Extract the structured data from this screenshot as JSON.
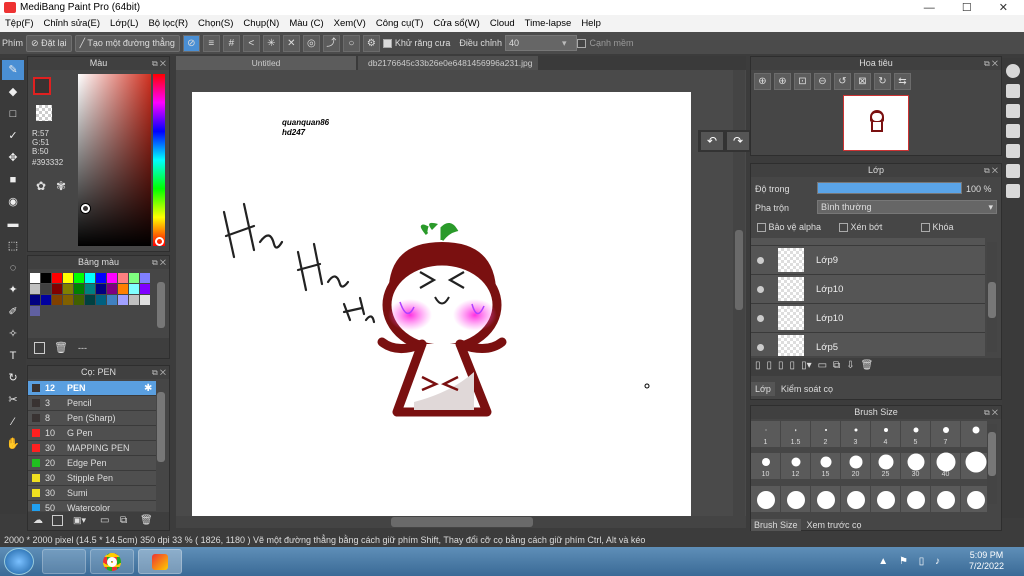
{
  "window": {
    "title": "MediBang Paint Pro (64bit)",
    "controls": "— ☐ ✕"
  },
  "menu": [
    "Tệp(F)",
    "Chỉnh sửa(E)",
    "Lớp(L)",
    "Bộ lọc(R)",
    "Chọn(S)",
    "Chụp(N)",
    "Màu (C)",
    "Xem(V)",
    "Công cụ(T)",
    "Cửa sổ(W)",
    "Cloud",
    "Time-lapse",
    "Help"
  ],
  "toolbar": {
    "label": "Phím",
    "reset": "Đặt lại",
    "straight_line": "Tạo một đường thẳng",
    "antialias": "Khử răng cưa",
    "adjust": "Điều chỉnh",
    "adjust_value": "40",
    "smooth": "Cạnh mềm"
  },
  "color_panel": {
    "title": "Màu",
    "r": "R:57",
    "g": "G:51",
    "b": "B:50",
    "hex": "#393332",
    "primary": "#393332",
    "secondary": "#c8e020"
  },
  "palette_panel": {
    "title": "Bảng màu",
    "footer": "---",
    "colors": [
      "#ffffff",
      "#000000",
      "#ff0000",
      "#ffff00",
      "#00ff00",
      "#00ffff",
      "#0000ff",
      "#ff00ff",
      "#ff8080",
      "#80ff80",
      "#8080ff",
      "#c0c0c0",
      "#404040",
      "#800000",
      "#808000",
      "#008000",
      "#008080",
      "#000080",
      "#800080",
      "#ff8000",
      "#80ffff",
      "#8000ff",
      "#000080",
      "#0000a0",
      "#804000",
      "#806000",
      "#406000",
      "#004040",
      "#006080",
      "#4080c0",
      "#a0a0ff",
      "#c0c0c0",
      "#e0e0e0",
      "#6060a0"
    ]
  },
  "brush_panel": {
    "title": "Cọ: PEN",
    "items": [
      {
        "size": "12",
        "name": "PEN",
        "color": "#393332"
      },
      {
        "size": "3",
        "name": "Pencil",
        "color": "#393332"
      },
      {
        "size": "8",
        "name": "Pen (Sharp)",
        "color": "#393332"
      },
      {
        "size": "10",
        "name": "G Pen",
        "color": "#ff2020"
      },
      {
        "size": "30",
        "name": "MAPPING PEN",
        "color": "#ff2020"
      },
      {
        "size": "20",
        "name": "Edge Pen",
        "color": "#20c020"
      },
      {
        "size": "30",
        "name": "Stipple Pen",
        "color": "#f0e020"
      },
      {
        "size": "30",
        "name": "Sumi",
        "color": "#f0e020"
      },
      {
        "size": "50",
        "name": "Watercolor",
        "color": "#20a0f0"
      }
    ]
  },
  "tabs": [
    "Untitled",
    "db2176645c33b26e0e6481456996a231.jpg"
  ],
  "canvas": {
    "sig1": "quanquan86",
    "sig2": "hd247"
  },
  "navigator": {
    "title": "Hoa tiêu"
  },
  "layers_panel": {
    "title": "Lớp",
    "opacity_label": "Độ trong",
    "opacity_value": "100 %",
    "opacity": 1.0,
    "blend_label": "Pha trộn",
    "blend_value": "Bình thường",
    "protect_alpha": "Bảo vệ alpha",
    "clipping": "Xén bớt",
    "lock": "Khóa",
    "layers": [
      "Lớp9",
      "Lớp10",
      "Lớp10",
      "Lớp5"
    ],
    "tab1": "Lớp",
    "tab2": "Kiểm soát cọ"
  },
  "brushsize_panel": {
    "title": "Brush Size",
    "sizes": [
      "1",
      "1.5",
      "2",
      "3",
      "4",
      "5",
      "7",
      "",
      "10",
      "12",
      "15",
      "20",
      "25",
      "30",
      "40",
      ""
    ],
    "tab1": "Brush Size",
    "tab2": "Xem trước cọ"
  },
  "status": {
    "text": "2000 * 2000 pixel   (14.5 * 14.5cm)   350 dpi   33 %   ( 1826, 1180 )   Vẽ một đường thẳng bằng cách giữ phím Shift, Thay đổi cỡ cọ bằng cách giữ phím Ctrl, Alt và kéo"
  },
  "taskbar": {
    "time": "5:09 PM",
    "date": "7/2/2022"
  }
}
